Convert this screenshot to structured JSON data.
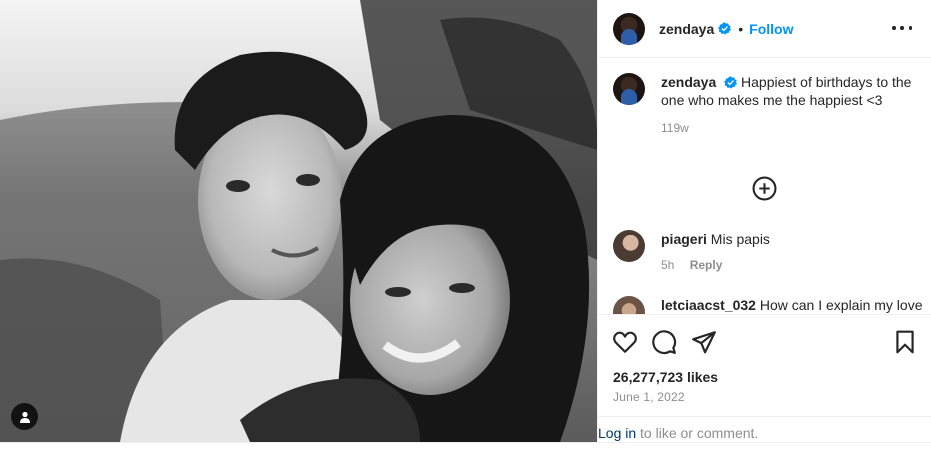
{
  "post": {
    "author": "zendaya",
    "follow_label": "Follow",
    "separator": "•",
    "caption_text": "Happiest of birthdays to the one who makes me the happiest <3",
    "caption_age": "119w",
    "likes": "26,277,723 likes",
    "date": "June 1, 2022"
  },
  "comments": [
    {
      "user": "piageri",
      "text": "Mis papis",
      "age": "5h",
      "reply_label": "Reply"
    },
    {
      "user": "letciaacst_032",
      "text": "How can I explain my love"
    }
  ],
  "login": {
    "link": "Log in",
    "rest": "to like or comment."
  },
  "icons": {
    "verified": "verified-badge-icon",
    "more": "more-options-icon",
    "load_more": "plus-circle-icon",
    "like": "heart-icon",
    "comment": "comment-icon",
    "share": "share-icon",
    "save": "bookmark-icon",
    "tags": "user-tag-icon"
  },
  "colors": {
    "accent": "#0095f6",
    "link": "#00376b",
    "muted": "#8e8e8e",
    "text": "#262626"
  }
}
